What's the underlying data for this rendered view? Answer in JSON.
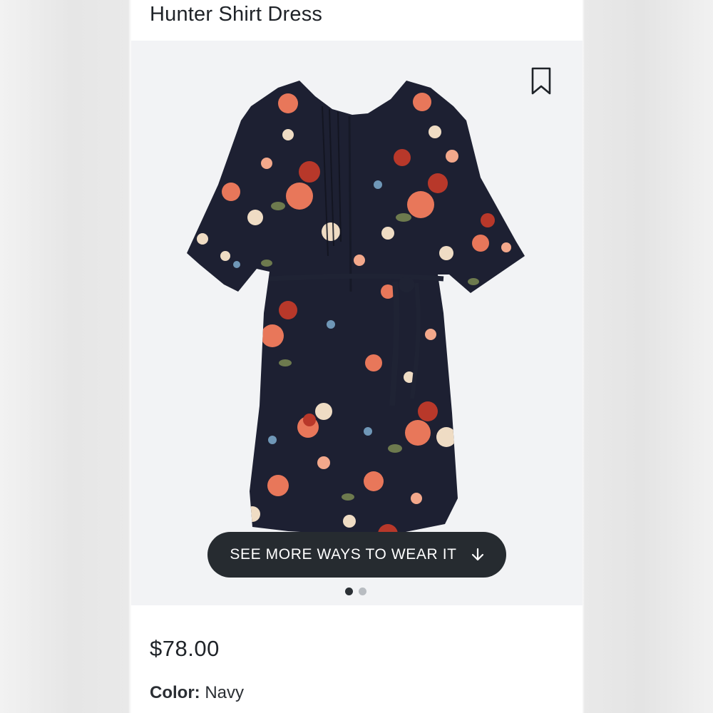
{
  "product": {
    "name": "Hunter Shirt Dress",
    "price": "$78.00",
    "color_label": "Color:",
    "color_value": "Navy"
  },
  "gallery": {
    "cta_label": "SEE MORE WAYS TO WEAR IT",
    "cta_icon": "arrow-down-icon",
    "bookmark_icon": "bookmark-icon",
    "image_count": 2,
    "active_index": 1
  },
  "colors": {
    "dress_base": "#1d2032",
    "cta_bg": "#262b30",
    "media_bg": "#f2f3f5"
  }
}
